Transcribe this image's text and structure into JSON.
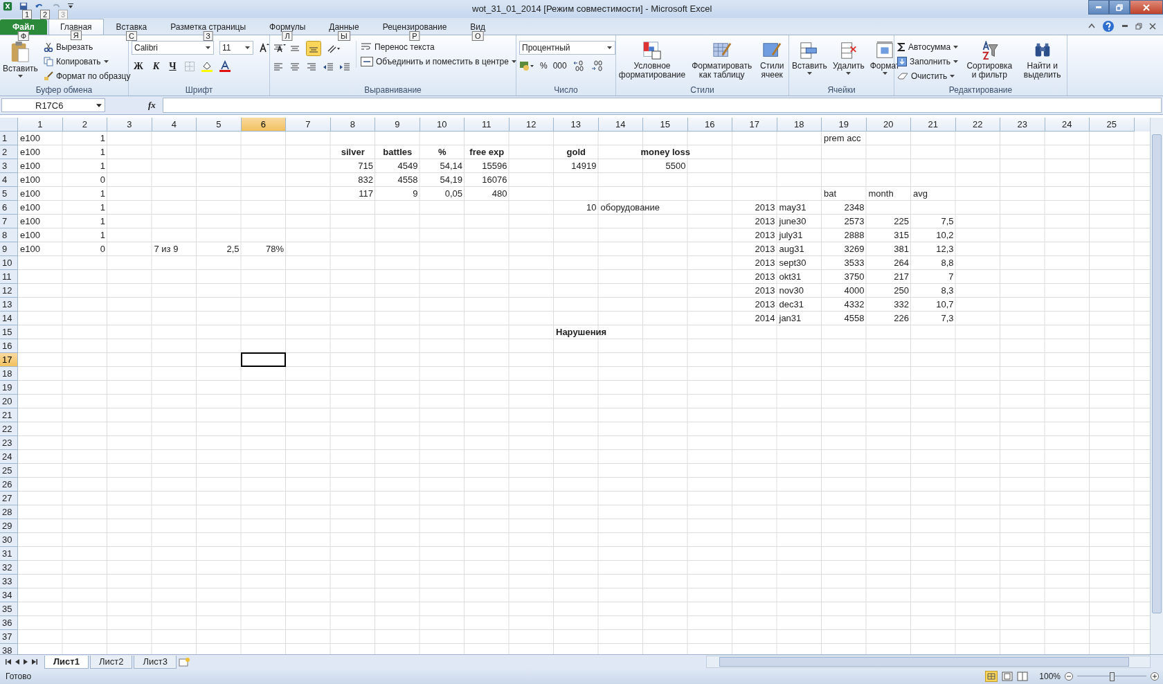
{
  "window": {
    "title": "wot_31_01_2014  [Режим совместимости]  -  Microsoft Excel"
  },
  "quick_access": [
    {
      "keytip": "1",
      "disabled": false
    },
    {
      "keytip": "2",
      "disabled": false
    },
    {
      "keytip": "3",
      "disabled": true
    }
  ],
  "tabs": [
    {
      "label": "Файл",
      "keytip": "Ф",
      "kind": "file",
      "selected": false
    },
    {
      "label": "Главная",
      "keytip": "Я",
      "kind": "tab",
      "selected": true
    },
    {
      "label": "Вставка",
      "keytip": "С",
      "kind": "tab",
      "selected": false
    },
    {
      "label": "Разметка страницы",
      "keytip": "З",
      "kind": "tab",
      "selected": false
    },
    {
      "label": "Формулы",
      "keytip": "Л",
      "kind": "tab",
      "selected": false
    },
    {
      "label": "Данные",
      "keytip": "Ы",
      "kind": "tab",
      "selected": false
    },
    {
      "label": "Рецензирование",
      "keytip": "Р",
      "kind": "tab",
      "selected": false
    },
    {
      "label": "Вид",
      "keytip": "О",
      "kind": "tab",
      "selected": false
    }
  ],
  "clipboard": {
    "paste": "Вставить",
    "cut": "Вырезать",
    "copy": "Копировать",
    "format_painter": "Формат по образцу",
    "label": "Буфер обмена"
  },
  "font": {
    "name": "Calibri",
    "size": "11",
    "bold": "Ж",
    "italic": "К",
    "underline": "Ч",
    "label": "Шрифт"
  },
  "alignment": {
    "wrap": "Перенос текста",
    "merge": "Объединить и поместить в центре",
    "label": "Выравнивание"
  },
  "number": {
    "format": "Процентный",
    "percent": "%",
    "thousands": "000",
    "label": "Число"
  },
  "styles": {
    "conditional": "Условное форматирование",
    "table": "Форматировать как таблицу",
    "cell": "Стили ячеек",
    "label": "Стили"
  },
  "cells_group": {
    "insert": "Вставить",
    "delete": "Удалить",
    "format": "Формат",
    "label": "Ячейки"
  },
  "editing": {
    "autosum": "Автосумма",
    "fill": "Заполнить",
    "clear": "Очистить",
    "sort": "Сортировка и фильтр",
    "find": "Найти и выделить",
    "label": "Редактирование"
  },
  "name_box": "R17C6",
  "function_label": "fx",
  "columns": [
    {
      "label": "1",
      "selected": false
    },
    {
      "label": "2",
      "selected": false
    },
    {
      "label": "3",
      "selected": false
    },
    {
      "label": "4",
      "selected": false
    },
    {
      "label": "5",
      "selected": false
    },
    {
      "label": "6",
      "selected": true
    },
    {
      "label": "7",
      "selected": false
    },
    {
      "label": "8",
      "selected": false
    },
    {
      "label": "9",
      "selected": false
    },
    {
      "label": "10",
      "selected": false
    },
    {
      "label": "11",
      "selected": false
    },
    {
      "label": "12",
      "selected": false
    },
    {
      "label": "13",
      "selected": false
    },
    {
      "label": "14",
      "selected": false
    },
    {
      "label": "15",
      "selected": false
    },
    {
      "label": "16",
      "selected": false
    },
    {
      "label": "17",
      "selected": false
    },
    {
      "label": "18",
      "selected": false
    },
    {
      "label": "19",
      "selected": false
    },
    {
      "label": "20",
      "selected": false
    },
    {
      "label": "21",
      "selected": false
    },
    {
      "label": "22",
      "selected": false
    },
    {
      "label": "23",
      "selected": false
    },
    {
      "label": "24",
      "selected": false
    },
    {
      "label": "25",
      "selected": false
    }
  ],
  "rows": [
    {
      "label": "1",
      "selected": false,
      "cells": [
        {
          "text": "e100",
          "kind": "text"
        },
        {
          "text": "1",
          "kind": "number"
        },
        null,
        null,
        null,
        null,
        null,
        null,
        null,
        null,
        null,
        null,
        null,
        null,
        null,
        null,
        null,
        null,
        {
          "text": "prem acc",
          "kind": "text"
        }
      ]
    },
    {
      "label": "2",
      "selected": false,
      "cells": [
        {
          "text": "e100",
          "kind": "text"
        },
        {
          "text": "1",
          "kind": "number"
        },
        null,
        null,
        null,
        null,
        null,
        {
          "text": "silver",
          "kind": "heading"
        },
        {
          "text": "battles",
          "kind": "heading"
        },
        {
          "text": "%",
          "kind": "heading"
        },
        {
          "text": "free exp",
          "kind": "heading"
        },
        null,
        {
          "text": "gold",
          "kind": "heading"
        },
        null,
        {
          "text": "money loss",
          "kind": "heading"
        }
      ]
    },
    {
      "label": "3",
      "selected": false,
      "cells": [
        {
          "text": "e100",
          "kind": "text"
        },
        {
          "text": "1",
          "kind": "number"
        },
        null,
        null,
        null,
        null,
        null,
        {
          "text": "715",
          "kind": "number"
        },
        {
          "text": "4549",
          "kind": "number"
        },
        {
          "text": "54,14",
          "kind": "number"
        },
        {
          "text": "15596",
          "kind": "number"
        },
        null,
        {
          "text": "14919",
          "kind": "number"
        },
        null,
        {
          "text": "5500",
          "kind": "number"
        }
      ]
    },
    {
      "label": "4",
      "selected": false,
      "cells": [
        {
          "text": "e100",
          "kind": "text"
        },
        {
          "text": "0",
          "kind": "number"
        },
        null,
        null,
        null,
        null,
        null,
        {
          "text": "832",
          "kind": "number"
        },
        {
          "text": "4558",
          "kind": "number"
        },
        {
          "text": "54,19",
          "kind": "number"
        },
        {
          "text": "16076",
          "kind": "number"
        }
      ]
    },
    {
      "label": "5",
      "selected": false,
      "cells": [
        {
          "text": "e100",
          "kind": "text"
        },
        {
          "text": "1",
          "kind": "number"
        },
        null,
        null,
        null,
        null,
        null,
        {
          "text": "117",
          "kind": "number"
        },
        {
          "text": "9",
          "kind": "number"
        },
        {
          "text": "0,05",
          "kind": "number"
        },
        {
          "text": "480",
          "kind": "number"
        },
        null,
        null,
        null,
        null,
        null,
        null,
        null,
        {
          "text": "bat",
          "kind": "text"
        },
        {
          "text": "month",
          "kind": "text"
        },
        {
          "text": "avg",
          "kind": "text"
        }
      ]
    },
    {
      "label": "6",
      "selected": false,
      "cells": [
        {
          "text": "e100",
          "kind": "text"
        },
        {
          "text": "1",
          "kind": "number"
        },
        null,
        null,
        null,
        null,
        null,
        null,
        null,
        null,
        null,
        null,
        {
          "text": "10",
          "kind": "number"
        },
        {
          "text": "оборудование",
          "kind": "text"
        },
        null,
        null,
        {
          "text": "2013",
          "kind": "number"
        },
        {
          "text": "may31",
          "kind": "text"
        },
        {
          "text": "2348",
          "kind": "number"
        }
      ]
    },
    {
      "label": "7",
      "selected": false,
      "cells": [
        {
          "text": "e100",
          "kind": "text"
        },
        {
          "text": "1",
          "kind": "number"
        },
        null,
        null,
        null,
        null,
        null,
        null,
        null,
        null,
        null,
        null,
        null,
        null,
        null,
        null,
        {
          "text": "2013",
          "kind": "number"
        },
        {
          "text": "june30",
          "kind": "text"
        },
        {
          "text": "2573",
          "kind": "number"
        },
        {
          "text": "225",
          "kind": "number"
        },
        {
          "text": "7,5",
          "kind": "number"
        }
      ]
    },
    {
      "label": "8",
      "selected": false,
      "cells": [
        {
          "text": "e100",
          "kind": "text"
        },
        {
          "text": "1",
          "kind": "number"
        },
        null,
        null,
        null,
        null,
        null,
        null,
        null,
        null,
        null,
        null,
        null,
        null,
        null,
        null,
        {
          "text": "2013",
          "kind": "number"
        },
        {
          "text": "july31",
          "kind": "text"
        },
        {
          "text": "2888",
          "kind": "number"
        },
        {
          "text": "315",
          "kind": "number"
        },
        {
          "text": "10,2",
          "kind": "number"
        }
      ]
    },
    {
      "label": "9",
      "selected": false,
      "cells": [
        {
          "text": "e100",
          "kind": "text"
        },
        {
          "text": "0",
          "kind": "number"
        },
        null,
        {
          "text": "7 из 9",
          "kind": "text"
        },
        {
          "text": "2,5",
          "kind": "number"
        },
        {
          "text": "78%",
          "kind": "number"
        },
        null,
        null,
        null,
        null,
        null,
        null,
        null,
        null,
        null,
        null,
        {
          "text": "2013",
          "kind": "number"
        },
        {
          "text": "aug31",
          "kind": "text"
        },
        {
          "text": "3269",
          "kind": "number"
        },
        {
          "text": "381",
          "kind": "number"
        },
        {
          "text": "12,3",
          "kind": "number"
        }
      ]
    },
    {
      "label": "10",
      "selected": false,
      "cells": [
        null,
        null,
        null,
        null,
        null,
        null,
        null,
        null,
        null,
        null,
        null,
        null,
        null,
        null,
        null,
        null,
        {
          "text": "2013",
          "kind": "number"
        },
        {
          "text": "sept30",
          "kind": "text"
        },
        {
          "text": "3533",
          "kind": "number"
        },
        {
          "text": "264",
          "kind": "number"
        },
        {
          "text": "8,8",
          "kind": "number"
        }
      ]
    },
    {
      "label": "11",
      "selected": false,
      "cells": [
        null,
        null,
        null,
        null,
        null,
        null,
        null,
        null,
        null,
        null,
        null,
        null,
        null,
        null,
        null,
        null,
        {
          "text": "2013",
          "kind": "number"
        },
        {
          "text": "okt31",
          "kind": "text"
        },
        {
          "text": "3750",
          "kind": "number"
        },
        {
          "text": "217",
          "kind": "number"
        },
        {
          "text": "7",
          "kind": "number"
        }
      ]
    },
    {
      "label": "12",
      "selected": false,
      "cells": [
        null,
        null,
        null,
        null,
        null,
        null,
        null,
        null,
        null,
        null,
        null,
        null,
        null,
        null,
        null,
        null,
        {
          "text": "2013",
          "kind": "number"
        },
        {
          "text": "nov30",
          "kind": "text"
        },
        {
          "text": "4000",
          "kind": "number"
        },
        {
          "text": "250",
          "kind": "number"
        },
        {
          "text": "8,3",
          "kind": "number"
        }
      ]
    },
    {
      "label": "13",
      "selected": false,
      "cells": [
        null,
        null,
        null,
        null,
        null,
        null,
        null,
        null,
        null,
        null,
        null,
        null,
        null,
        null,
        null,
        null,
        {
          "text": "2013",
          "kind": "number"
        },
        {
          "text": "dec31",
          "kind": "text"
        },
        {
          "text": "4332",
          "kind": "number"
        },
        {
          "text": "332",
          "kind": "number"
        },
        {
          "text": "10,7",
          "kind": "number"
        }
      ]
    },
    {
      "label": "14",
      "selected": false,
      "cells": [
        null,
        null,
        null,
        null,
        null,
        null,
        null,
        null,
        null,
        null,
        null,
        null,
        null,
        null,
        null,
        null,
        {
          "text": "2014",
          "kind": "number"
        },
        {
          "text": "jan31",
          "kind": "text"
        },
        {
          "text": "4558",
          "kind": "number"
        },
        {
          "text": "226",
          "kind": "number"
        },
        {
          "text": "7,3",
          "kind": "number"
        }
      ]
    },
    {
      "label": "15",
      "selected": false,
      "cells": [
        null,
        null,
        null,
        null,
        null,
        null,
        null,
        null,
        null,
        null,
        null,
        null,
        {
          "text": "Нарушения",
          "kind": "bold_text"
        }
      ]
    },
    {
      "label": "16",
      "selected": false
    },
    {
      "label": "17",
      "selected": true
    },
    {
      "label": "18",
      "selected": false
    },
    {
      "label": "19",
      "selected": false
    },
    {
      "label": "20",
      "selected": false
    },
    {
      "label": "21",
      "selected": false
    },
    {
      "label": "22",
      "selected": false
    },
    {
      "label": "23",
      "selected": false
    },
    {
      "label": "24",
      "selected": false
    },
    {
      "label": "25",
      "selected": false
    },
    {
      "label": "26",
      "selected": false
    },
    {
      "label": "27",
      "selected": false
    },
    {
      "label": "28",
      "selected": false
    },
    {
      "label": "29",
      "selected": false
    },
    {
      "label": "30",
      "selected": false
    },
    {
      "label": "31",
      "selected": false
    },
    {
      "label": "32",
      "selected": false
    },
    {
      "label": "33",
      "selected": false
    },
    {
      "label": "34",
      "selected": false
    },
    {
      "label": "35",
      "selected": false
    },
    {
      "label": "36",
      "selected": false
    },
    {
      "label": "37",
      "selected": false
    },
    {
      "label": "38",
      "selected": false
    }
  ],
  "sheets": [
    {
      "label": "Лист1",
      "selected": true
    },
    {
      "label": "Лист2",
      "selected": false
    },
    {
      "label": "Лист3",
      "selected": false
    }
  ],
  "status_bar": {
    "text": "Готово",
    "zoom": "100%",
    "zoom_slider": {
      "level": 0.5
    }
  }
}
